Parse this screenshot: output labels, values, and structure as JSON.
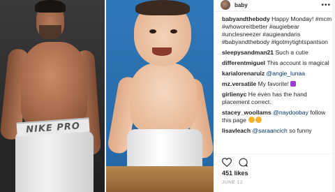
{
  "post": {
    "header_name": "baby",
    "author": "babyandthebody",
    "caption": "Happy Monday! #mcm #whoworeitbetter #augiebear #unclesneezer #augieandaris #babyandthebody #igotmytightspantson",
    "likes": "451 likes",
    "date": "JUNE 12",
    "photo_waistband_text": "NIKE PRO"
  },
  "comments": [
    {
      "user": "sleepysandman21",
      "text": "Such a cutie"
    },
    {
      "user": "differentmiguel",
      "text": "This account is magical"
    },
    {
      "user": "karialorenaruiz",
      "mention": "@angie_lunaa",
      "text": ""
    },
    {
      "user": "mz.versatile",
      "text": "My favorite!",
      "emoji": "purple-heart"
    },
    {
      "user": "girlienyc",
      "text": "He even has the hand placement correct."
    },
    {
      "user": "stacey_woollams",
      "mention": "@naydoobay",
      "text": "follow this page",
      "emoji": "grinning-face"
    },
    {
      "user": "lisavleach",
      "mention": "@saraancich",
      "text": "so funny"
    }
  ],
  "icons": {
    "like": "heart-icon",
    "comment": "comment-icon",
    "more": "more-options-icon"
  },
  "colors": {
    "text": "#262626",
    "link": "#003569",
    "muted": "#999999",
    "baby_photo_bg": "#2a6fae"
  }
}
